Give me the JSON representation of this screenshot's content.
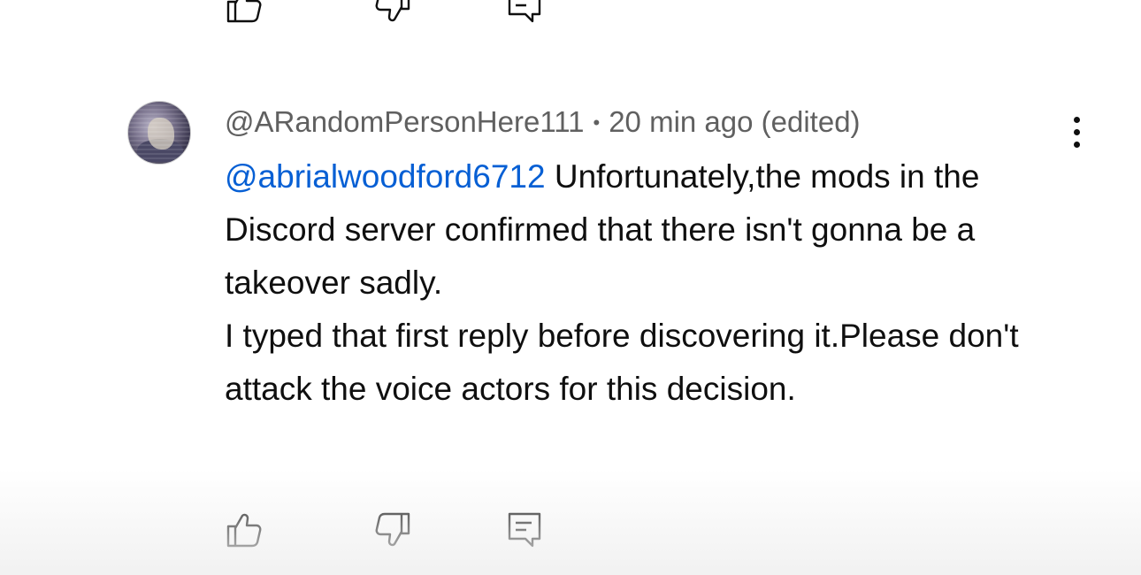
{
  "comment": {
    "author_handle": "@ARandomPersonHere111",
    "separator": "•",
    "timestamp": "20 min ago",
    "edited_flag": "(edited)",
    "mention": "@abrialwoodford6712",
    "text_part1": " Unfortunately,the mods in the Discord server confirmed that there isn't gonna be a takeover sadly.",
    "text_part2": "I typed that first reply before discovering it.Please don't attack the voice actors for this decision."
  },
  "colors": {
    "mention": "#065fd4",
    "meta_text": "#606060",
    "body_text": "#0f0f0f"
  },
  "icons": {
    "like": "thumbs-up-icon",
    "dislike": "thumbs-down-icon",
    "reply": "reply-comment-icon",
    "more": "more-vertical-icon"
  }
}
